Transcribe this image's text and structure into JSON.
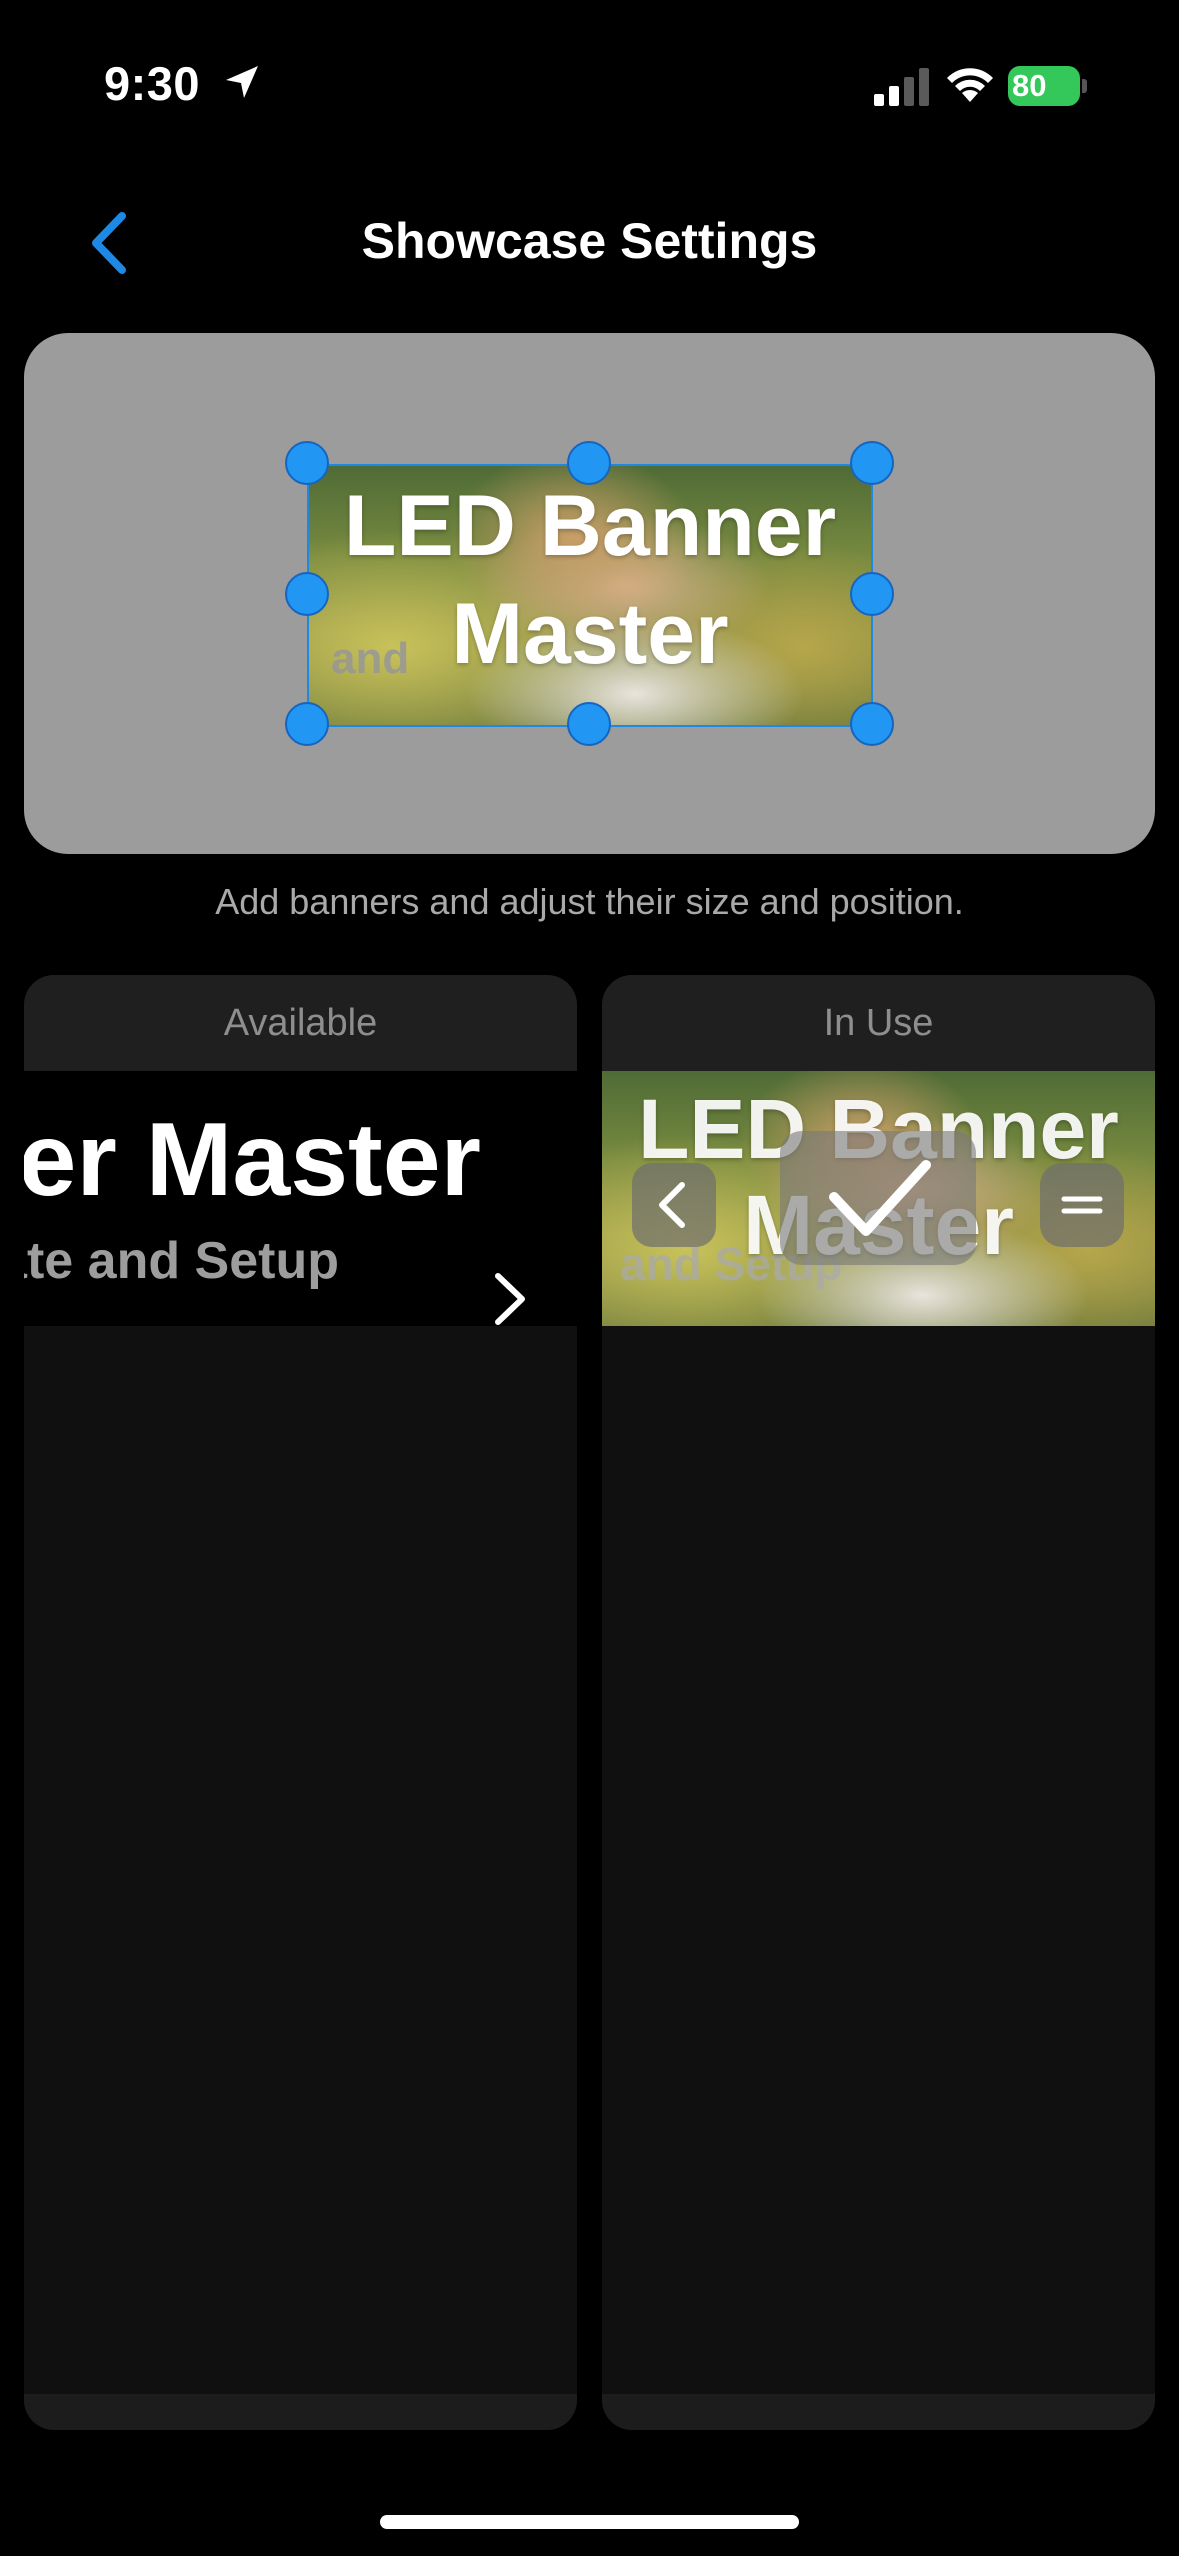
{
  "status_bar": {
    "time": "9:30",
    "battery": "80"
  },
  "nav": {
    "title": "Showcase Settings",
    "back_icon": "chevron-left-icon"
  },
  "preview": {
    "banner_line1": "LED Banner",
    "banner_line2": "Master",
    "banner_sub": "and",
    "hint": "Add banners and adjust their size and position."
  },
  "available": {
    "header": "Available",
    "item_title": "LED Banner Master",
    "item_subtitle": "Create and Setup"
  },
  "in_use": {
    "header": "In Use",
    "banner_line1": "LED Banner",
    "banner_line2": "Master",
    "banner_sub": "and Setup"
  },
  "colors": {
    "accent": "#2196f3",
    "battery": "#34c759",
    "preview_bg": "#9c9c9c",
    "panel_bg": "#101010"
  }
}
